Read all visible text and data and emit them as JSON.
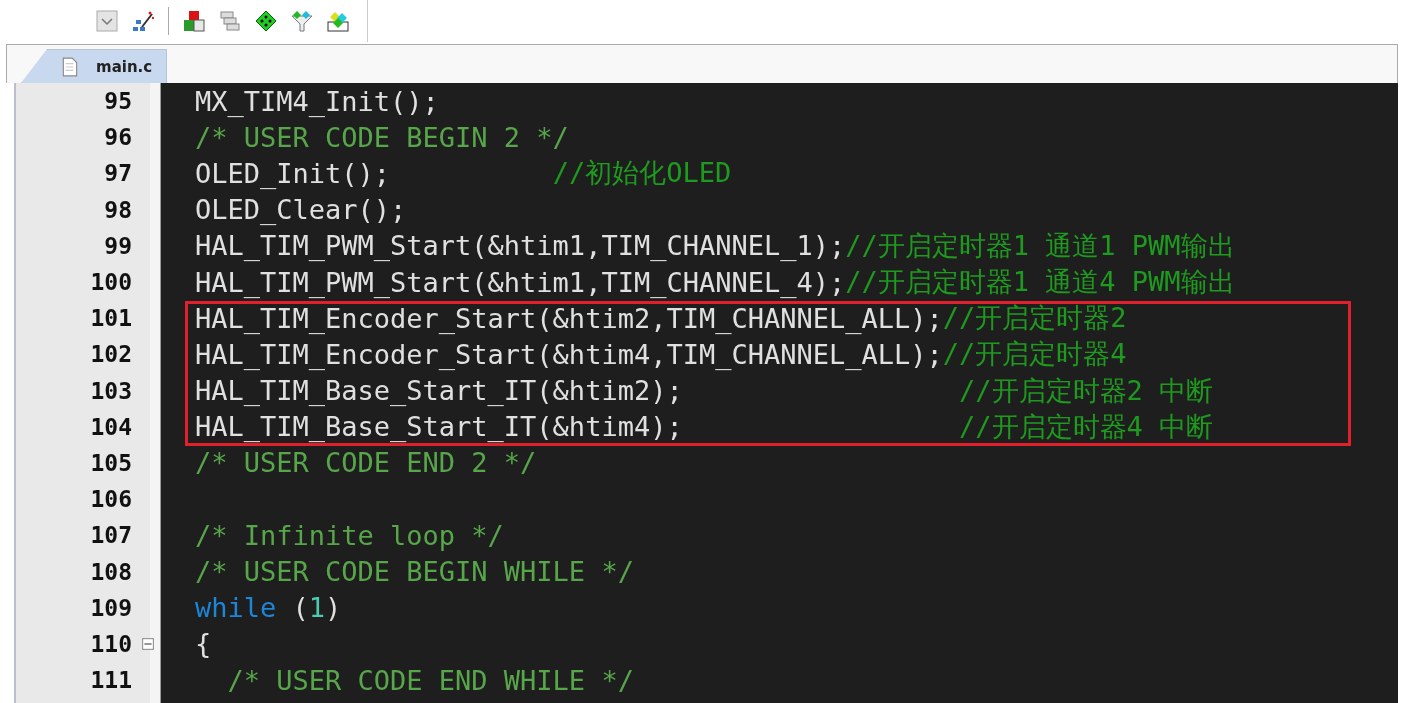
{
  "tabs": [
    {
      "label": "main.c",
      "selected": true
    }
  ],
  "lines": [
    {
      "number": "95",
      "tokens": [
        {
          "kind": "plain",
          "text": "MX_TIM4_Init();"
        }
      ]
    },
    {
      "number": "96",
      "tokens": [
        {
          "kind": "comment",
          "text": "/* USER CODE BEGIN 2 */"
        }
      ]
    },
    {
      "number": "97",
      "tokens": [
        {
          "kind": "plain",
          "text": "OLED_Init();          "
        },
        {
          "kind": "line-comment",
          "text": "//初始化OLED"
        }
      ]
    },
    {
      "number": "98",
      "tokens": [
        {
          "kind": "plain",
          "text": "OLED_Clear();"
        }
      ]
    },
    {
      "number": "99",
      "tokens": [
        {
          "kind": "plain",
          "text": "HAL_TIM_PWM_Start(&htim1,TIM_CHANNEL_1);"
        },
        {
          "kind": "line-comment",
          "text": "//开启定时器1 通道1 PWM输出"
        }
      ]
    },
    {
      "number": "100",
      "tokens": [
        {
          "kind": "plain",
          "text": "HAL_TIM_PWM_Start(&htim1,TIM_CHANNEL_4);"
        },
        {
          "kind": "line-comment",
          "text": "//开启定时器1 通道4 PWM输出"
        }
      ]
    },
    {
      "number": "101",
      "highlighted": true,
      "tokens": [
        {
          "kind": "plain",
          "text": "HAL_TIM_Encoder_Start(&htim2,TIM_CHANNEL_ALL);"
        },
        {
          "kind": "line-comment",
          "text": "//开启定时器2"
        }
      ]
    },
    {
      "number": "102",
      "highlighted": true,
      "tokens": [
        {
          "kind": "plain",
          "text": "HAL_TIM_Encoder_Start(&htim4,TIM_CHANNEL_ALL);"
        },
        {
          "kind": "line-comment",
          "text": "//开启定时器4"
        }
      ]
    },
    {
      "number": "103",
      "highlighted": true,
      "tokens": [
        {
          "kind": "plain",
          "text": "HAL_TIM_Base_Start_IT(&htim2);                 "
        },
        {
          "kind": "line-comment",
          "text": "//开启定时器2 中断"
        }
      ]
    },
    {
      "number": "104",
      "highlighted": true,
      "tokens": [
        {
          "kind": "plain",
          "text": "HAL_TIM_Base_Start_IT(&htim4);                 "
        },
        {
          "kind": "line-comment",
          "text": "//开启定时器4 中断"
        }
      ]
    },
    {
      "number": "105",
      "tokens": [
        {
          "kind": "comment",
          "text": "/* USER CODE END 2 */"
        }
      ]
    },
    {
      "number": "106"
    },
    {
      "number": "107",
      "tokens": [
        {
          "kind": "comment",
          "text": "/* Infinite loop */"
        }
      ]
    },
    {
      "number": "108",
      "tokens": [
        {
          "kind": "comment",
          "text": "/* USER CODE BEGIN WHILE */"
        }
      ]
    },
    {
      "number": "109",
      "tokens": [
        {
          "kind": "keyword",
          "text": "while"
        },
        {
          "kind": "plain",
          "text": " ("
        },
        {
          "kind": "number",
          "text": "1"
        },
        {
          "kind": "plain",
          "text": ")"
        }
      ]
    },
    {
      "number": "110",
      "expanded": true,
      "tokens": [
        {
          "kind": "plain",
          "text": "{"
        }
      ]
    },
    {
      "number": "111",
      "tokens": [
        {
          "kind": "comment",
          "text": "  /* USER CODE END WHILE */"
        }
      ]
    }
  ]
}
